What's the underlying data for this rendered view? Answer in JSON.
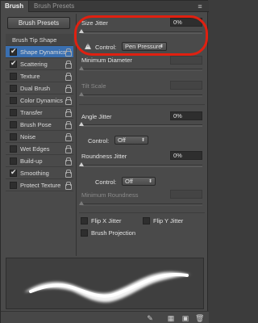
{
  "tabs": [
    {
      "label": "Brush"
    },
    {
      "label": "Brush Presets"
    }
  ],
  "left": {
    "presets_button": "Brush Presets",
    "options": [
      {
        "label": "Brush Tip Shape",
        "checked": null,
        "selected": false
      },
      {
        "label": "Shape Dynamics",
        "checked": true,
        "selected": true
      },
      {
        "label": "Scattering",
        "checked": true,
        "selected": false
      },
      {
        "label": "Texture",
        "checked": false,
        "selected": false
      },
      {
        "label": "Dual Brush",
        "checked": false,
        "selected": false
      },
      {
        "label": "Color Dynamics",
        "checked": false,
        "selected": false
      },
      {
        "label": "Transfer",
        "checked": false,
        "selected": false
      },
      {
        "label": "Brush Pose",
        "checked": false,
        "selected": false
      },
      {
        "label": "Noise",
        "checked": false,
        "selected": false
      },
      {
        "label": "Wet Edges",
        "checked": false,
        "selected": false
      },
      {
        "label": "Build-up",
        "checked": false,
        "selected": false
      },
      {
        "label": "Smoothing",
        "checked": true,
        "selected": false
      },
      {
        "label": "Protect Texture",
        "checked": false,
        "selected": false
      }
    ]
  },
  "right": {
    "size_jitter": {
      "label": "Size Jitter",
      "value": "0%",
      "slider": 0
    },
    "size_control": {
      "label": "Control:",
      "value": "Pen Pressure"
    },
    "min_diameter": {
      "label": "Minimum Diameter"
    },
    "tilt_scale": {
      "label": "Tilt Scale"
    },
    "angle_jitter": {
      "label": "Angle Jitter",
      "value": "0%",
      "slider": 0
    },
    "angle_control": {
      "label": "Control:",
      "value": "Off"
    },
    "roundness_jitter": {
      "label": "Roundness Jitter",
      "value": "0%",
      "slider": 0
    },
    "roundness_control": {
      "label": "Control:",
      "value": "Off"
    },
    "min_roundness": {
      "label": "Minimum Roundness"
    },
    "flip_x": {
      "label": "Flip X Jitter",
      "checked": false
    },
    "flip_y": {
      "label": "Flip Y Jitter",
      "checked": false
    },
    "brush_projection": {
      "label": "Brush Projection",
      "checked": false
    }
  },
  "colors": {
    "panel": "#4a4a4a",
    "selection": "#3a6fb0",
    "highlight": "#e02010"
  },
  "icons": [
    "panel-menu-icon",
    "lock-icon",
    "warning-icon",
    "toggle-live-tip-icon",
    "grid-icon",
    "new-preset-icon",
    "trash-icon"
  ]
}
